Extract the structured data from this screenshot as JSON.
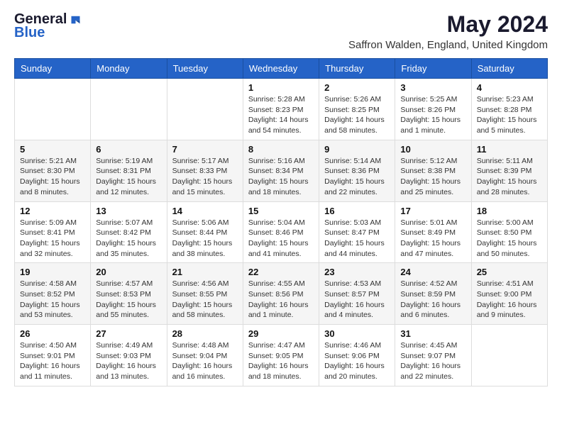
{
  "logo": {
    "general": "General",
    "blue": "Blue"
  },
  "title": {
    "month_year": "May 2024",
    "location": "Saffron Walden, England, United Kingdom"
  },
  "weekdays": [
    "Sunday",
    "Monday",
    "Tuesday",
    "Wednesday",
    "Thursday",
    "Friday",
    "Saturday"
  ],
  "weeks": [
    [
      {
        "day": "",
        "sunrise": "",
        "sunset": "",
        "daylight": ""
      },
      {
        "day": "",
        "sunrise": "",
        "sunset": "",
        "daylight": ""
      },
      {
        "day": "",
        "sunrise": "",
        "sunset": "",
        "daylight": ""
      },
      {
        "day": "1",
        "sunrise": "Sunrise: 5:28 AM",
        "sunset": "Sunset: 8:23 PM",
        "daylight": "Daylight: 14 hours and 54 minutes."
      },
      {
        "day": "2",
        "sunrise": "Sunrise: 5:26 AM",
        "sunset": "Sunset: 8:25 PM",
        "daylight": "Daylight: 14 hours and 58 minutes."
      },
      {
        "day": "3",
        "sunrise": "Sunrise: 5:25 AM",
        "sunset": "Sunset: 8:26 PM",
        "daylight": "Daylight: 15 hours and 1 minute."
      },
      {
        "day": "4",
        "sunrise": "Sunrise: 5:23 AM",
        "sunset": "Sunset: 8:28 PM",
        "daylight": "Daylight: 15 hours and 5 minutes."
      }
    ],
    [
      {
        "day": "5",
        "sunrise": "Sunrise: 5:21 AM",
        "sunset": "Sunset: 8:30 PM",
        "daylight": "Daylight: 15 hours and 8 minutes."
      },
      {
        "day": "6",
        "sunrise": "Sunrise: 5:19 AM",
        "sunset": "Sunset: 8:31 PM",
        "daylight": "Daylight: 15 hours and 12 minutes."
      },
      {
        "day": "7",
        "sunrise": "Sunrise: 5:17 AM",
        "sunset": "Sunset: 8:33 PM",
        "daylight": "Daylight: 15 hours and 15 minutes."
      },
      {
        "day": "8",
        "sunrise": "Sunrise: 5:16 AM",
        "sunset": "Sunset: 8:34 PM",
        "daylight": "Daylight: 15 hours and 18 minutes."
      },
      {
        "day": "9",
        "sunrise": "Sunrise: 5:14 AM",
        "sunset": "Sunset: 8:36 PM",
        "daylight": "Daylight: 15 hours and 22 minutes."
      },
      {
        "day": "10",
        "sunrise": "Sunrise: 5:12 AM",
        "sunset": "Sunset: 8:38 PM",
        "daylight": "Daylight: 15 hours and 25 minutes."
      },
      {
        "day": "11",
        "sunrise": "Sunrise: 5:11 AM",
        "sunset": "Sunset: 8:39 PM",
        "daylight": "Daylight: 15 hours and 28 minutes."
      }
    ],
    [
      {
        "day": "12",
        "sunrise": "Sunrise: 5:09 AM",
        "sunset": "Sunset: 8:41 PM",
        "daylight": "Daylight: 15 hours and 32 minutes."
      },
      {
        "day": "13",
        "sunrise": "Sunrise: 5:07 AM",
        "sunset": "Sunset: 8:42 PM",
        "daylight": "Daylight: 15 hours and 35 minutes."
      },
      {
        "day": "14",
        "sunrise": "Sunrise: 5:06 AM",
        "sunset": "Sunset: 8:44 PM",
        "daylight": "Daylight: 15 hours and 38 minutes."
      },
      {
        "day": "15",
        "sunrise": "Sunrise: 5:04 AM",
        "sunset": "Sunset: 8:46 PM",
        "daylight": "Daylight: 15 hours and 41 minutes."
      },
      {
        "day": "16",
        "sunrise": "Sunrise: 5:03 AM",
        "sunset": "Sunset: 8:47 PM",
        "daylight": "Daylight: 15 hours and 44 minutes."
      },
      {
        "day": "17",
        "sunrise": "Sunrise: 5:01 AM",
        "sunset": "Sunset: 8:49 PM",
        "daylight": "Daylight: 15 hours and 47 minutes."
      },
      {
        "day": "18",
        "sunrise": "Sunrise: 5:00 AM",
        "sunset": "Sunset: 8:50 PM",
        "daylight": "Daylight: 15 hours and 50 minutes."
      }
    ],
    [
      {
        "day": "19",
        "sunrise": "Sunrise: 4:58 AM",
        "sunset": "Sunset: 8:52 PM",
        "daylight": "Daylight: 15 hours and 53 minutes."
      },
      {
        "day": "20",
        "sunrise": "Sunrise: 4:57 AM",
        "sunset": "Sunset: 8:53 PM",
        "daylight": "Daylight: 15 hours and 55 minutes."
      },
      {
        "day": "21",
        "sunrise": "Sunrise: 4:56 AM",
        "sunset": "Sunset: 8:55 PM",
        "daylight": "Daylight: 15 hours and 58 minutes."
      },
      {
        "day": "22",
        "sunrise": "Sunrise: 4:55 AM",
        "sunset": "Sunset: 8:56 PM",
        "daylight": "Daylight: 16 hours and 1 minute."
      },
      {
        "day": "23",
        "sunrise": "Sunrise: 4:53 AM",
        "sunset": "Sunset: 8:57 PM",
        "daylight": "Daylight: 16 hours and 4 minutes."
      },
      {
        "day": "24",
        "sunrise": "Sunrise: 4:52 AM",
        "sunset": "Sunset: 8:59 PM",
        "daylight": "Daylight: 16 hours and 6 minutes."
      },
      {
        "day": "25",
        "sunrise": "Sunrise: 4:51 AM",
        "sunset": "Sunset: 9:00 PM",
        "daylight": "Daylight: 16 hours and 9 minutes."
      }
    ],
    [
      {
        "day": "26",
        "sunrise": "Sunrise: 4:50 AM",
        "sunset": "Sunset: 9:01 PM",
        "daylight": "Daylight: 16 hours and 11 minutes."
      },
      {
        "day": "27",
        "sunrise": "Sunrise: 4:49 AM",
        "sunset": "Sunset: 9:03 PM",
        "daylight": "Daylight: 16 hours and 13 minutes."
      },
      {
        "day": "28",
        "sunrise": "Sunrise: 4:48 AM",
        "sunset": "Sunset: 9:04 PM",
        "daylight": "Daylight: 16 hours and 16 minutes."
      },
      {
        "day": "29",
        "sunrise": "Sunrise: 4:47 AM",
        "sunset": "Sunset: 9:05 PM",
        "daylight": "Daylight: 16 hours and 18 minutes."
      },
      {
        "day": "30",
        "sunrise": "Sunrise: 4:46 AM",
        "sunset": "Sunset: 9:06 PM",
        "daylight": "Daylight: 16 hours and 20 minutes."
      },
      {
        "day": "31",
        "sunrise": "Sunrise: 4:45 AM",
        "sunset": "Sunset: 9:07 PM",
        "daylight": "Daylight: 16 hours and 22 minutes."
      },
      {
        "day": "",
        "sunrise": "",
        "sunset": "",
        "daylight": ""
      }
    ]
  ]
}
